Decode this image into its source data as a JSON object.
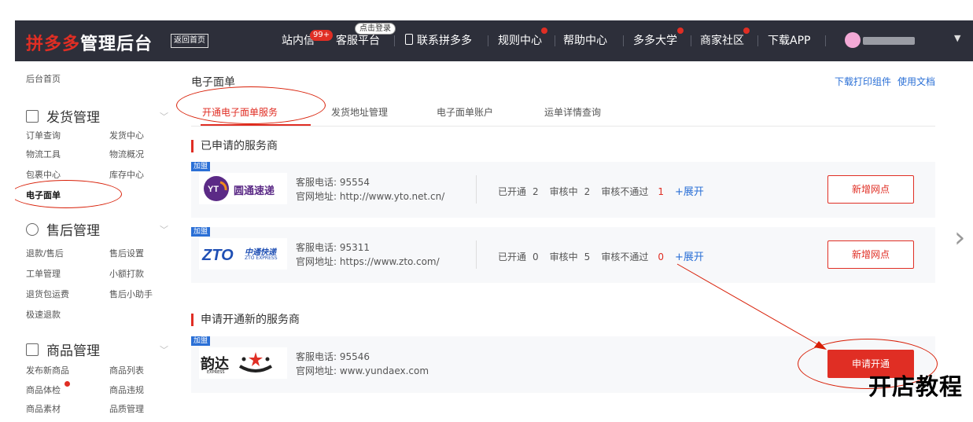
{
  "header": {
    "brand": "拼多多",
    "title": "管理后台",
    "back_home": "返回首页",
    "nav": {
      "inbox": "站内信",
      "inbox_badge": "99+",
      "service": "客服平台",
      "service_bubble": "点击登录",
      "contact": "联系拼多多",
      "rules": "规则中心",
      "help": "帮助中心",
      "university": "多多大学",
      "community": "商家社区",
      "app": "下载APP"
    }
  },
  "sidebar": {
    "home": "后台首页",
    "groups": [
      {
        "title": "发货管理",
        "items": [
          "订单查询",
          "发货中心",
          "物流工具",
          "物流概况",
          "包裹中心",
          "库存中心",
          "电子面单"
        ]
      },
      {
        "title": "售后管理",
        "items": [
          "退款/售后",
          "售后设置",
          "工单管理",
          "小额打款",
          "退货包运费",
          "售后小助手",
          "极速退款"
        ]
      },
      {
        "title": "商品管理",
        "items": [
          "发布新商品",
          "商品列表",
          "商品体检",
          "商品违规",
          "商品素材",
          "品质管理"
        ]
      }
    ]
  },
  "main": {
    "title": "电子面单",
    "links": [
      "下载打印组件",
      "使用文档"
    ],
    "tabs": [
      "开通电子面单服务",
      "发货地址管理",
      "电子面单账户",
      "运单详情查询"
    ],
    "section_applied": "已申请的服务商",
    "section_new": "申请开通新的服务商",
    "join_tag": "加盟",
    "labels": {
      "phone": "客服电话:",
      "site": "官网地址:",
      "opened": "已开通",
      "reviewing": "审核中",
      "rejected": "审核不通过",
      "expand": "+展开"
    },
    "providers": [
      {
        "logo_text": "圆通速递",
        "phone": "95554",
        "site": "http://www.yto.net.cn/",
        "opened": "2",
        "reviewing": "2",
        "rejected": "1",
        "action": "新增网点"
      },
      {
        "logo_text": "中通快递",
        "logo_sub": "ZTO EXPRESS",
        "phone": "95311",
        "site": "https://www.zto.com/",
        "opened": "0",
        "reviewing": "5",
        "rejected": "0",
        "action": "新增网点"
      }
    ],
    "new_providers": [
      {
        "logo_text": "韵达",
        "logo_sub": "EXPRESS",
        "phone": "95546",
        "site": "www.yundaex.com",
        "action": "申请开通"
      }
    ]
  },
  "overlay": {
    "watermark": "开店教程"
  },
  "colors": {
    "accent": "#e02e24",
    "header_bg": "#2d2f3a",
    "link": "#2a6fd6"
  }
}
